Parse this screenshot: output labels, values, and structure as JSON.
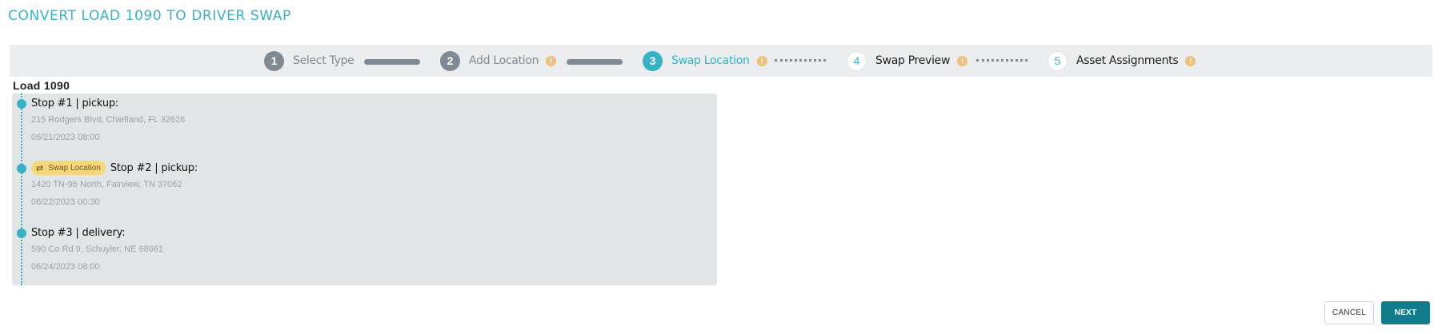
{
  "header": {
    "title": "CONVERT LOAD 1090 TO DRIVER SWAP"
  },
  "stepper": {
    "steps": [
      {
        "number": "1",
        "label": "Select Type",
        "state": "done"
      },
      {
        "number": "2",
        "label": "Add Location",
        "state": "done",
        "info_icon": "!"
      },
      {
        "number": "3",
        "label": "Swap Location",
        "state": "active",
        "info_icon": "!"
      },
      {
        "number": "4",
        "label": "Swap Preview",
        "state": "todo",
        "info_icon": "!"
      },
      {
        "number": "5",
        "label": "Asset Assignments",
        "state": "todo",
        "info_icon": "!"
      }
    ],
    "colors": {
      "active": "#35b3c4",
      "done": "#7f8a94",
      "info": "#f0c17a"
    }
  },
  "load": {
    "title": "Load 1090",
    "stops": [
      {
        "title": "Stop #1 | pickup:",
        "address": "215 Rodgers Blvd, Chiefland, FL 32626",
        "datetime": "06/21/2023 08:00"
      },
      {
        "title": "Stop #2 | pickup:",
        "address": "1420 TN-96 North, Fairview, TN 37062",
        "datetime": "06/22/2023 00:30",
        "badge": {
          "icon": "swap-icon",
          "glyph": "⇄",
          "label": "Swap Location",
          "color": "#f7d77b"
        }
      },
      {
        "title": "Stop #3 | delivery:",
        "address": "590 Co Rd 9, Schuyler, NE 68661",
        "datetime": "06/24/2023 08:00"
      }
    ]
  },
  "footer": {
    "cancel_label": "CANCEL",
    "next_label": "NEXT",
    "next_color": "#137c8b"
  }
}
